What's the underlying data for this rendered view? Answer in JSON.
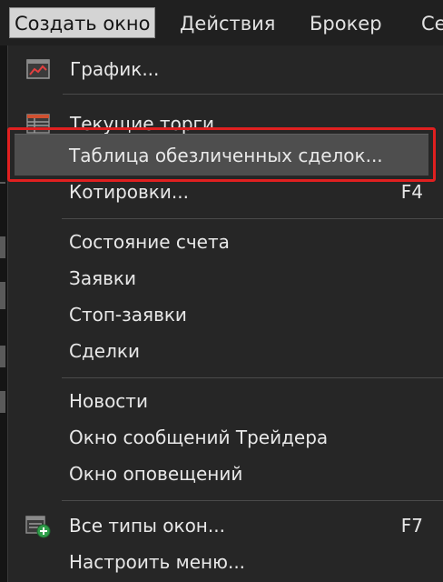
{
  "menubar": {
    "items": [
      "Создать окно",
      "Действия",
      "Брокер",
      "Се"
    ]
  },
  "dropdown": {
    "items": [
      {
        "label": "График...",
        "icon": "chart-icon"
      },
      {
        "label": "Текущие торги...",
        "icon": "table-icon"
      },
      {
        "label": "Таблица обезличенных сделок..."
      },
      {
        "label": "Котировки...",
        "shortcut": "F4"
      },
      {
        "label": "Состояние счета"
      },
      {
        "label": "Заявки"
      },
      {
        "label": "Стоп-заявки"
      },
      {
        "label": "Сделки"
      },
      {
        "label": "Новости"
      },
      {
        "label": "Окно сообщений Трейдера"
      },
      {
        "label": "Окно оповещений"
      },
      {
        "label": "Все типы окон...",
        "icon": "add-window-icon",
        "shortcut": "F7"
      },
      {
        "label": "Настроить меню..."
      }
    ]
  },
  "colors": {
    "highlight_border": "#e02020",
    "menu_bg": "#262626",
    "hover_bg": "#4e4e4e"
  }
}
